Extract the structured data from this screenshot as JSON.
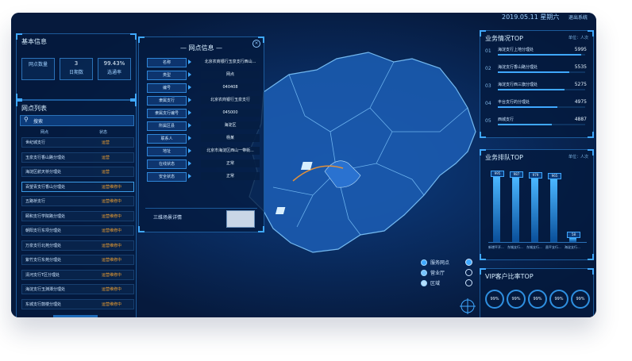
{
  "header": {
    "date": "2019.05.11 星期六",
    "exit": "退出系统"
  },
  "basic_info": {
    "title": "基本信息",
    "stats": [
      {
        "value": "",
        "label": "网点数量"
      },
      {
        "value": "3",
        "label": "日期数"
      },
      {
        "value": "99.43%",
        "label": "选通率"
      }
    ]
  },
  "branch_list": {
    "title": "网点列表",
    "search": "搜索",
    "col_name": "网点",
    "col_status": "状态",
    "items": [
      {
        "name": "世纪城支行",
        "status": "运营"
      },
      {
        "name": "玉泉支行香山路分理处",
        "status": "运营"
      },
      {
        "name": "海淀区航天桥分理处",
        "status": "运营"
      },
      {
        "name": "百望青支行香山分理处",
        "status": "运营维修中"
      },
      {
        "name": "五路桥支行",
        "status": "运营维修中"
      },
      {
        "name": "颐和支行学院路分理处",
        "status": "运营维修中"
      },
      {
        "name": "朝阳支行东坝分理处",
        "status": "运营维修中"
      },
      {
        "name": "万泉支行北苑分理处",
        "status": "运营维修中"
      },
      {
        "name": "紫竹支行东苑分理处",
        "status": "运营维修中"
      },
      {
        "name": "清河支行T区分理处",
        "status": "运营维修中"
      },
      {
        "name": "海淀支行玉渊潭分理处",
        "status": "运营维修中"
      },
      {
        "name": "东城支行鼓楼分理处",
        "status": "运营维修中"
      }
    ]
  },
  "branch_info": {
    "title": "网点信息",
    "fields": [
      {
        "label": "名称",
        "value": "北京农商银行玉泉支行西山..."
      },
      {
        "label": "类型",
        "value": "网点"
      },
      {
        "label": "编号",
        "value": "040408"
      },
      {
        "label": "隶属支行",
        "value": "北京农商银行玉泉支行"
      },
      {
        "label": "隶属支行编号",
        "value": "045000"
      },
      {
        "label": "所属区县",
        "value": "海淀区"
      },
      {
        "label": "联系人",
        "value": "杨某"
      },
      {
        "label": "地址",
        "value": "北京市海淀区西山一带街..."
      },
      {
        "label": "在线状态",
        "value": "正常"
      },
      {
        "label": "安全状态",
        "value": "正常"
      }
    ],
    "view3d": "三维场景详情"
  },
  "map_legend": [
    {
      "label": "服务网点",
      "color": "#3fa8ff"
    },
    {
      "label": "营业厅",
      "color": "#77c4ff"
    },
    {
      "label": "区域",
      "color": "#b5e0ff"
    }
  ],
  "biz_top": {
    "title": "业务情况TOP",
    "unit": "单位：人次",
    "items": [
      {
        "rank": "01",
        "name": "海淀支行上地分理处",
        "value": "5995",
        "pct": 0.95
      },
      {
        "rank": "02",
        "name": "海淀支行香山路分理处",
        "value": "5535",
        "pct": 0.82
      },
      {
        "rank": "03",
        "name": "海淀支行西三旗分理处",
        "value": "5275",
        "pct": 0.76
      },
      {
        "rank": "04",
        "name": "丰台支行的分理处",
        "value": "4975",
        "pct": 0.68
      },
      {
        "rank": "05",
        "name": "西城支行",
        "value": "4887",
        "pct": 0.62
      }
    ]
  },
  "chart_data": {
    "type": "bar",
    "title": "业务排队TOP",
    "ylabel": "单位：人次",
    "categories": [
      "新增平开...",
      "东城支行...",
      "东城支行...",
      "昌平支行...",
      "海淀支行..."
    ],
    "values": [
      995,
      987,
      979,
      965,
      58
    ],
    "ylim": [
      0,
      1000
    ]
  },
  "vip_top": {
    "title": "VIP客户比率TOP",
    "items": [
      "99%",
      "99%",
      "99%",
      "99%",
      "99%"
    ]
  }
}
